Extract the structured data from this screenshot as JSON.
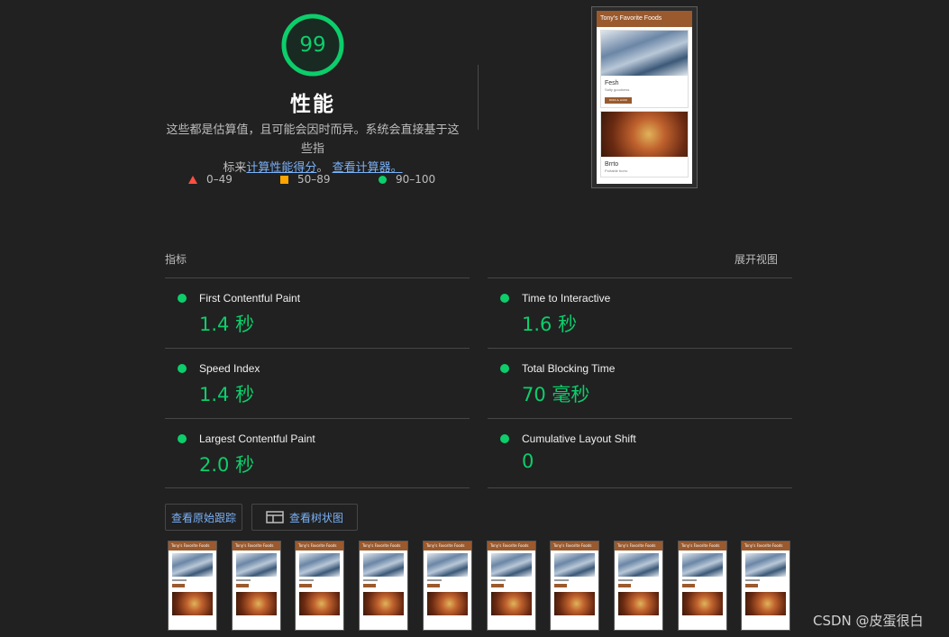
{
  "colors": {
    "pass": "#0cce6b",
    "average": "#ffa400",
    "fail": "#ff4e42",
    "link": "#7ab1f7"
  },
  "score": {
    "value": "99",
    "fraction": 0.99,
    "title": "性能"
  },
  "description": {
    "line1": "这些都是估算值，且可能会因时而异。系统会直接基于这些指",
    "line2_prefix": "标来",
    "link1": "计算性能得分",
    "sep": "。",
    "link2": "查看计算器。"
  },
  "legend": [
    {
      "icon": "triangle-fail-icon",
      "label": "0–49"
    },
    {
      "icon": "square-average-icon",
      "label": "50–89"
    },
    {
      "icon": "circle-pass-icon",
      "label": "90–100"
    }
  ],
  "screenshot": {
    "header": "Tony's Favorite Foods",
    "cards": [
      {
        "title": "Fesh",
        "subtitle": "Salty goodness",
        "button": "PASS & LOAD"
      },
      {
        "title": "Brrto",
        "subtitle": "Portable burro"
      }
    ]
  },
  "metrics_section": {
    "label": "指标",
    "expand": "展开视图"
  },
  "metrics": [
    {
      "name": "First Contentful Paint",
      "value": "1.4 秒"
    },
    {
      "name": "Time to Interactive",
      "value": "1.6 秒"
    },
    {
      "name": "Speed Index",
      "value": "1.4 秒"
    },
    {
      "name": "Total Blocking Time",
      "value": "70 毫秒"
    },
    {
      "name": "Largest Contentful Paint",
      "value": "2.0 秒"
    },
    {
      "name": "Cumulative Layout Shift",
      "value": "0"
    }
  ],
  "buttons": {
    "trace": "查看原始跟踪",
    "treemap": "查看树状图"
  },
  "filmstrip": {
    "header": "Tony's Favorite Foods",
    "count": 10
  },
  "watermark": "CSDN @皮蛋很白"
}
